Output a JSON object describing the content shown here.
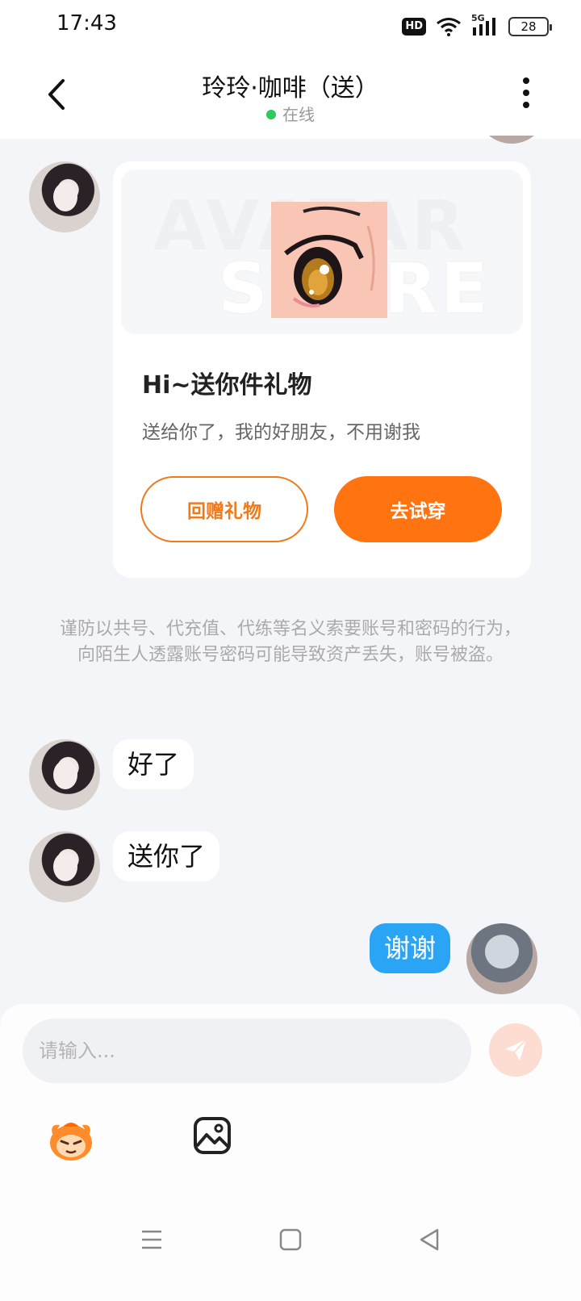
{
  "status_bar": {
    "time": "17:43",
    "hd_label": "HD",
    "network_label": "5G",
    "battery": "28"
  },
  "header": {
    "title": "玲玲·咖啡（送）",
    "status": "在线",
    "status_color": "#2ec95c"
  },
  "gift_card": {
    "watermark_1": "AVATAR",
    "watermark_2": "STORE",
    "title": "Hi~送你件礼物",
    "description": "送给你了，我的好朋友，不用谢我",
    "return_button": "回赠礼物",
    "try_button": "去试穿",
    "accent_color": "#ff7311"
  },
  "notice": "谨防以共号、代充值、代练等名义索要账号和密码的行为，向陌生人透露账号密码可能导致资产丢失，账号被盗。",
  "messages": [
    {
      "sender": "peer",
      "text": "好了"
    },
    {
      "sender": "peer",
      "text": "送你了"
    },
    {
      "sender": "self",
      "text": "谢谢"
    }
  ],
  "input": {
    "placeholder": "请输入..."
  },
  "icons": {
    "back": "chevron-left-icon",
    "more": "more-vertical-icon",
    "send": "send-icon",
    "emoji": "emoji-mascot-icon",
    "image": "image-icon",
    "nav_menu": "menu-icon",
    "nav_home": "home-square-icon",
    "nav_back": "back-triangle-icon"
  }
}
